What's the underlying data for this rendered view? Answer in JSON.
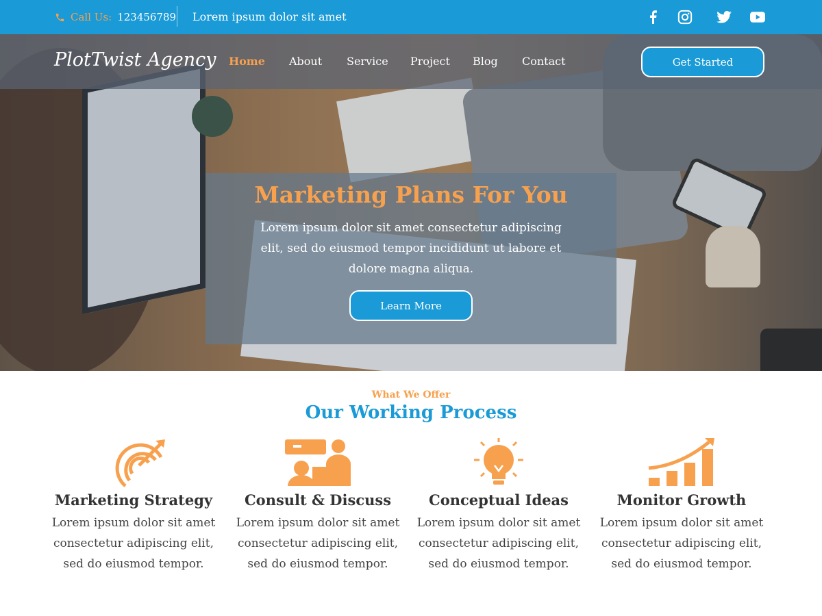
{
  "topbar": {
    "call_label": "Call Us:",
    "phone": "123456789",
    "tagline": "Lorem ipsum dolor sit amet",
    "social": [
      "facebook-icon",
      "instagram-icon",
      "twitter-icon",
      "youtube-icon"
    ]
  },
  "nav": {
    "logo": "PlotTwist Agency",
    "items": [
      {
        "label": "Home",
        "active": true
      },
      {
        "label": "About"
      },
      {
        "label": "Service"
      },
      {
        "label": "Project"
      },
      {
        "label": "Blog"
      },
      {
        "label": "Contact"
      }
    ],
    "cta": "Get Started"
  },
  "hero": {
    "title": "Marketing Plans For You",
    "text": "Lorem ipsum dolor sit amet consectetur adipiscing elit, sed do eiusmod tempor incididunt ut labore et dolore magna aliqua.",
    "button": "Learn More"
  },
  "process": {
    "eyebrow": "What We Offer",
    "title": "Our Working Process",
    "features": [
      {
        "icon": "target-icon",
        "title": "Marketing Strategy",
        "text": "Lorem ipsum dolor sit amet consectetur adipiscing elit, sed do eiusmod tempor."
      },
      {
        "icon": "consult-icon",
        "title": "Consult & Discuss",
        "text": "Lorem ipsum dolor sit amet consectetur adipiscing elit, sed do eiusmod tempor."
      },
      {
        "icon": "lightbulb-icon",
        "title": "Conceptual Ideas",
        "text": "Lorem ipsum dolor sit amet consectetur adipiscing elit, sed do eiusmod tempor."
      },
      {
        "icon": "growth-chart-icon",
        "title": "Monitor Growth",
        "text": "Lorem ipsum dolor sit amet consectetur adipiscing elit, sed do eiusmod tempor."
      }
    ]
  },
  "colors": {
    "primary": "#1a9ad6",
    "accent": "#f7a14f"
  }
}
